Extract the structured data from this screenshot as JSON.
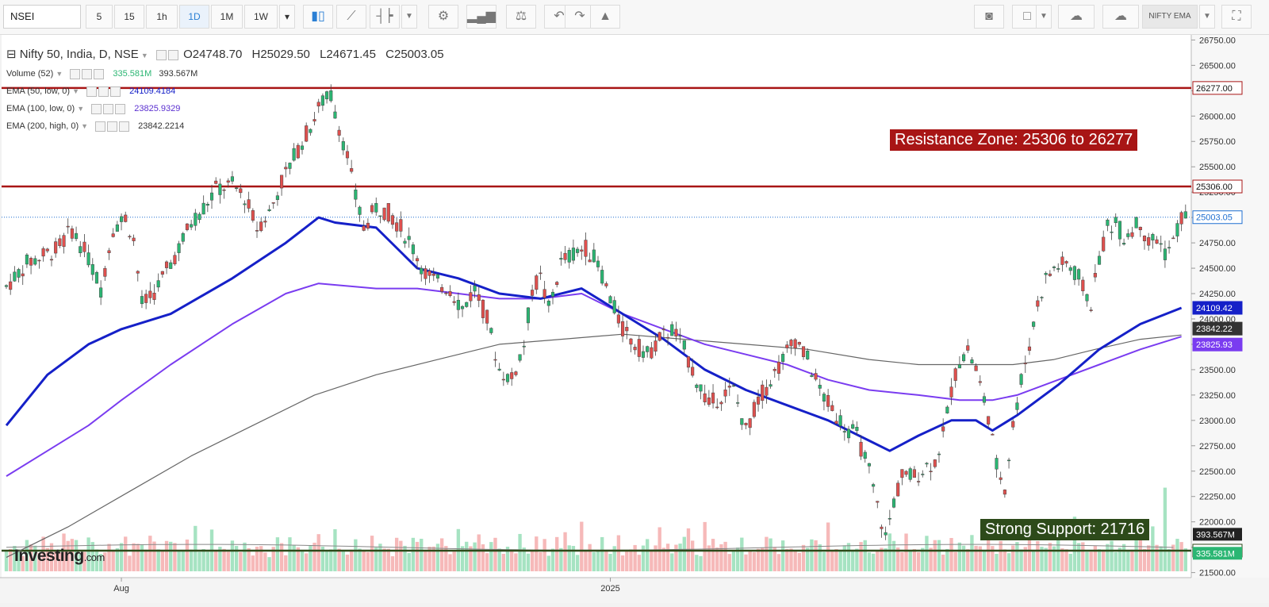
{
  "toolbar": {
    "symbol": "NSEI",
    "intervals": [
      "5",
      "15",
      "1h",
      "1D",
      "1M",
      "1W"
    ],
    "active_interval": "1D",
    "indicator_button": "NIFTY EMA",
    "icons": [
      "candles-icon",
      "line-chart-icon",
      "bar-chart-icon",
      "chevron-down-icon",
      "gear-icon",
      "indicators-icon",
      "balance-icon",
      "undo-icon",
      "redo-icon",
      "alert-icon",
      "camera-icon",
      "color-box-icon",
      "cloud-download-icon",
      "cloud-upload-icon",
      "fullscreen-icon"
    ]
  },
  "legend": {
    "main": {
      "name": "Nifty 50, India, D, NSE",
      "open": "O24748.70",
      "high": "H25029.50",
      "low": "L24671.45",
      "close": "C25003.05"
    },
    "volume": {
      "name": "Volume (52)",
      "v1": "335.581M",
      "v2": "393.567M"
    },
    "ema50": {
      "name": "EMA (50, low, 0)",
      "value": "24109.4184"
    },
    "ema100": {
      "name": "EMA (100, low, 0)",
      "value": "23825.9329"
    },
    "ema200": {
      "name": "EMA (200, high, 0)",
      "value": "23842.2214"
    }
  },
  "annotations": {
    "resistance_text": "Resistance Zone: 25306 to 26277",
    "support_text": "Strong Support: 21716"
  },
  "logo": {
    "text": "Investing",
    "suffix": ".com"
  },
  "colors": {
    "up": "#2bb673",
    "down": "#e0504e",
    "resistance": "#a81515",
    "support": "#2d4a1a",
    "ema50": "#1520c8",
    "ema100": "#7a3cf0",
    "ema200": "#666666",
    "vol_up": "#a6e3c2",
    "vol_down": "#f6b9b9",
    "last_price": "#1f6fd0"
  },
  "chart_data": {
    "type": "candlestick",
    "symbol": "Nifty 50, India, D, NSE",
    "x_labels": [
      {
        "label": "Aug",
        "index": 28
      },
      {
        "label": "2025",
        "index": 147
      }
    ],
    "ylim": [
      21450,
      26800
    ],
    "y_ticks": [
      21500,
      21750,
      22000,
      22250,
      22500,
      22750,
      23000,
      23250,
      23500,
      23750,
      24000,
      24250,
      24500,
      24750,
      25000,
      25250,
      25500,
      25750,
      26000,
      26250,
      26500,
      26750
    ],
    "last_close": 25003.05,
    "levels": [
      {
        "name": "resistance-top",
        "value": 26277.0,
        "label": "26277.00"
      },
      {
        "name": "resistance-bottom",
        "value": 25306.0,
        "label": "25306.00"
      },
      {
        "name": "support",
        "value": 21716.0,
        "label": "21716.00"
      }
    ],
    "axis_badges": [
      {
        "name": "last-price",
        "value": 25003.05,
        "label": "25003.05",
        "color": "#ffffff",
        "text": "#1f6fd0",
        "border": "#1f6fd0"
      },
      {
        "name": "ema50",
        "value": 24109.42,
        "label": "24109.42",
        "color": "#1520c8",
        "text": "#ffffff",
        "border": "#1520c8"
      },
      {
        "name": "ema200",
        "value": 23842.22,
        "label": "23842.22",
        "color": "#333333",
        "text": "#ffffff",
        "border": "#333333"
      },
      {
        "name": "ema100",
        "value": 23825.93,
        "label": "23825.93",
        "color": "#7a3cf0",
        "text": "#ffffff",
        "border": "#7a3cf0"
      }
    ],
    "volume_badges": [
      {
        "label": "393.567M",
        "color": "#222222",
        "vol": 400
      },
      {
        "label": "335.581M",
        "color": "#2bb673",
        "vol": 335
      }
    ],
    "price_path": [
      [
        0,
        24320
      ],
      [
        5,
        24550
      ],
      [
        12,
        24680
      ],
      [
        16,
        24880
      ],
      [
        20,
        24600
      ],
      [
        23,
        24300
      ],
      [
        26,
        24900
      ],
      [
        29,
        25000
      ],
      [
        31,
        24780
      ],
      [
        33,
        24150
      ],
      [
        35,
        24200
      ],
      [
        38,
        24400
      ],
      [
        42,
        24700
      ],
      [
        45,
        24950
      ],
      [
        48,
        25100
      ],
      [
        51,
        25280
      ],
      [
        55,
        25320
      ],
      [
        58,
        25200
      ],
      [
        61,
        24900
      ],
      [
        64,
        25050
      ],
      [
        67,
        25350
      ],
      [
        70,
        25600
      ],
      [
        74,
        25900
      ],
      [
        77,
        26150
      ],
      [
        79,
        26200
      ],
      [
        81,
        25900
      ],
      [
        83,
        25600
      ],
      [
        85,
        25200
      ],
      [
        87,
        24900
      ],
      [
        90,
        25100
      ],
      [
        93,
        25050
      ],
      [
        96,
        24900
      ],
      [
        99,
        24700
      ],
      [
        102,
        24450
      ],
      [
        105,
        24350
      ],
      [
        108,
        24300
      ],
      [
        111,
        24100
      ],
      [
        114,
        24300
      ],
      [
        117,
        24000
      ],
      [
        120,
        23500
      ],
      [
        123,
        23400
      ],
      [
        126,
        23750
      ],
      [
        128,
        24300
      ],
      [
        130,
        24400
      ],
      [
        132,
        24100
      ],
      [
        135,
        24550
      ],
      [
        138,
        24650
      ],
      [
        141,
        24700
      ],
      [
        144,
        24550
      ],
      [
        147,
        24200
      ],
      [
        150,
        23900
      ],
      [
        153,
        23750
      ],
      [
        156,
        23650
      ],
      [
        159,
        23800
      ],
      [
        162,
        23900
      ],
      [
        165,
        23700
      ],
      [
        168,
        23400
      ],
      [
        171,
        23150
      ],
      [
        174,
        23250
      ],
      [
        177,
        23300
      ],
      [
        180,
        22900
      ],
      [
        183,
        23200
      ],
      [
        186,
        23400
      ],
      [
        189,
        23600
      ],
      [
        192,
        23800
      ],
      [
        195,
        23600
      ],
      [
        198,
        23300
      ],
      [
        201,
        23100
      ],
      [
        204,
        22950
      ],
      [
        207,
        22850
      ],
      [
        210,
        22500
      ],
      [
        212,
        22150
      ],
      [
        214,
        21850
      ],
      [
        216,
        22200
      ],
      [
        218,
        22450
      ],
      [
        221,
        22450
      ],
      [
        224,
        22550
      ],
      [
        226,
        22600
      ],
      [
        228,
        22850
      ],
      [
        230,
        23300
      ],
      [
        232,
        23600
      ],
      [
        234,
        23700
      ],
      [
        236,
        23500
      ],
      [
        239,
        23050
      ],
      [
        241,
        22550
      ],
      [
        243,
        22350
      ],
      [
        245,
        22950
      ],
      [
        247,
        23400
      ],
      [
        249,
        23750
      ],
      [
        251,
        24150
      ],
      [
        253,
        24400
      ],
      [
        255,
        24500
      ],
      [
        258,
        24550
      ],
      [
        261,
        24400
      ],
      [
        264,
        24150
      ],
      [
        266,
        24600
      ],
      [
        268,
        24900
      ],
      [
        270,
        24950
      ],
      [
        272,
        24800
      ],
      [
        274,
        24900
      ],
      [
        276,
        24950
      ],
      [
        278,
        24750
      ],
      [
        280,
        24800
      ],
      [
        282,
        24650
      ],
      [
        284,
        24750
      ],
      [
        286,
        25000
      ]
    ],
    "ema50": {
      "name": "EMA (50, low, 0)",
      "points": [
        [
          0,
          22950
        ],
        [
          10,
          23450
        ],
        [
          20,
          23750
        ],
        [
          28,
          23900
        ],
        [
          40,
          24050
        ],
        [
          55,
          24400
        ],
        [
          68,
          24750
        ],
        [
          76,
          25000
        ],
        [
          80,
          24950
        ],
        [
          90,
          24900
        ],
        [
          100,
          24500
        ],
        [
          110,
          24400
        ],
        [
          120,
          24250
        ],
        [
          130,
          24200
        ],
        [
          140,
          24300
        ],
        [
          150,
          24050
        ],
        [
          160,
          23800
        ],
        [
          170,
          23500
        ],
        [
          180,
          23300
        ],
        [
          190,
          23150
        ],
        [
          200,
          23000
        ],
        [
          210,
          22800
        ],
        [
          215,
          22700
        ],
        [
          222,
          22850
        ],
        [
          230,
          23000
        ],
        [
          236,
          23000
        ],
        [
          240,
          22900
        ],
        [
          246,
          23050
        ],
        [
          256,
          23350
        ],
        [
          266,
          23700
        ],
        [
          276,
          23950
        ],
        [
          286,
          24109.42
        ]
      ]
    },
    "ema100": {
      "name": "EMA (100, low, 0)",
      "points": [
        [
          0,
          22450
        ],
        [
          10,
          22700
        ],
        [
          20,
          22950
        ],
        [
          28,
          23200
        ],
        [
          40,
          23550
        ],
        [
          55,
          23950
        ],
        [
          68,
          24250
        ],
        [
          76,
          24350
        ],
        [
          90,
          24300
        ],
        [
          100,
          24300
        ],
        [
          110,
          24250
        ],
        [
          120,
          24200
        ],
        [
          130,
          24200
        ],
        [
          140,
          24250
        ],
        [
          150,
          24050
        ],
        [
          160,
          23900
        ],
        [
          170,
          23750
        ],
        [
          180,
          23650
        ],
        [
          190,
          23550
        ],
        [
          200,
          23400
        ],
        [
          210,
          23300
        ],
        [
          222,
          23250
        ],
        [
          232,
          23200
        ],
        [
          240,
          23200
        ],
        [
          246,
          23250
        ],
        [
          256,
          23400
        ],
        [
          266,
          23550
        ],
        [
          276,
          23700
        ],
        [
          286,
          23825.93
        ]
      ]
    },
    "ema200": {
      "name": "EMA (200, high, 0)",
      "points": [
        [
          0,
          21650
        ],
        [
          15,
          21950
        ],
        [
          30,
          22300
        ],
        [
          45,
          22650
        ],
        [
          60,
          22950
        ],
        [
          75,
          23250
        ],
        [
          90,
          23450
        ],
        [
          105,
          23600
        ],
        [
          120,
          23750
        ],
        [
          135,
          23800
        ],
        [
          150,
          23850
        ],
        [
          165,
          23800
        ],
        [
          180,
          23750
        ],
        [
          195,
          23700
        ],
        [
          210,
          23600
        ],
        [
          222,
          23550
        ],
        [
          235,
          23550
        ],
        [
          245,
          23550
        ],
        [
          255,
          23600
        ],
        [
          265,
          23700
        ],
        [
          276,
          23800
        ],
        [
          286,
          23842.22
        ]
      ]
    },
    "volume_ylim": [
      0,
      1800
    ],
    "volume_pattern": [
      280,
      320,
      350,
      300,
      260,
      420,
      380,
      310,
      290,
      500,
      330,
      360,
      280,
      300,
      440,
      390,
      520,
      350,
      300,
      270,
      610,
      340,
      380,
      290,
      330,
      460,
      300,
      280,
      350,
      400
    ]
  }
}
